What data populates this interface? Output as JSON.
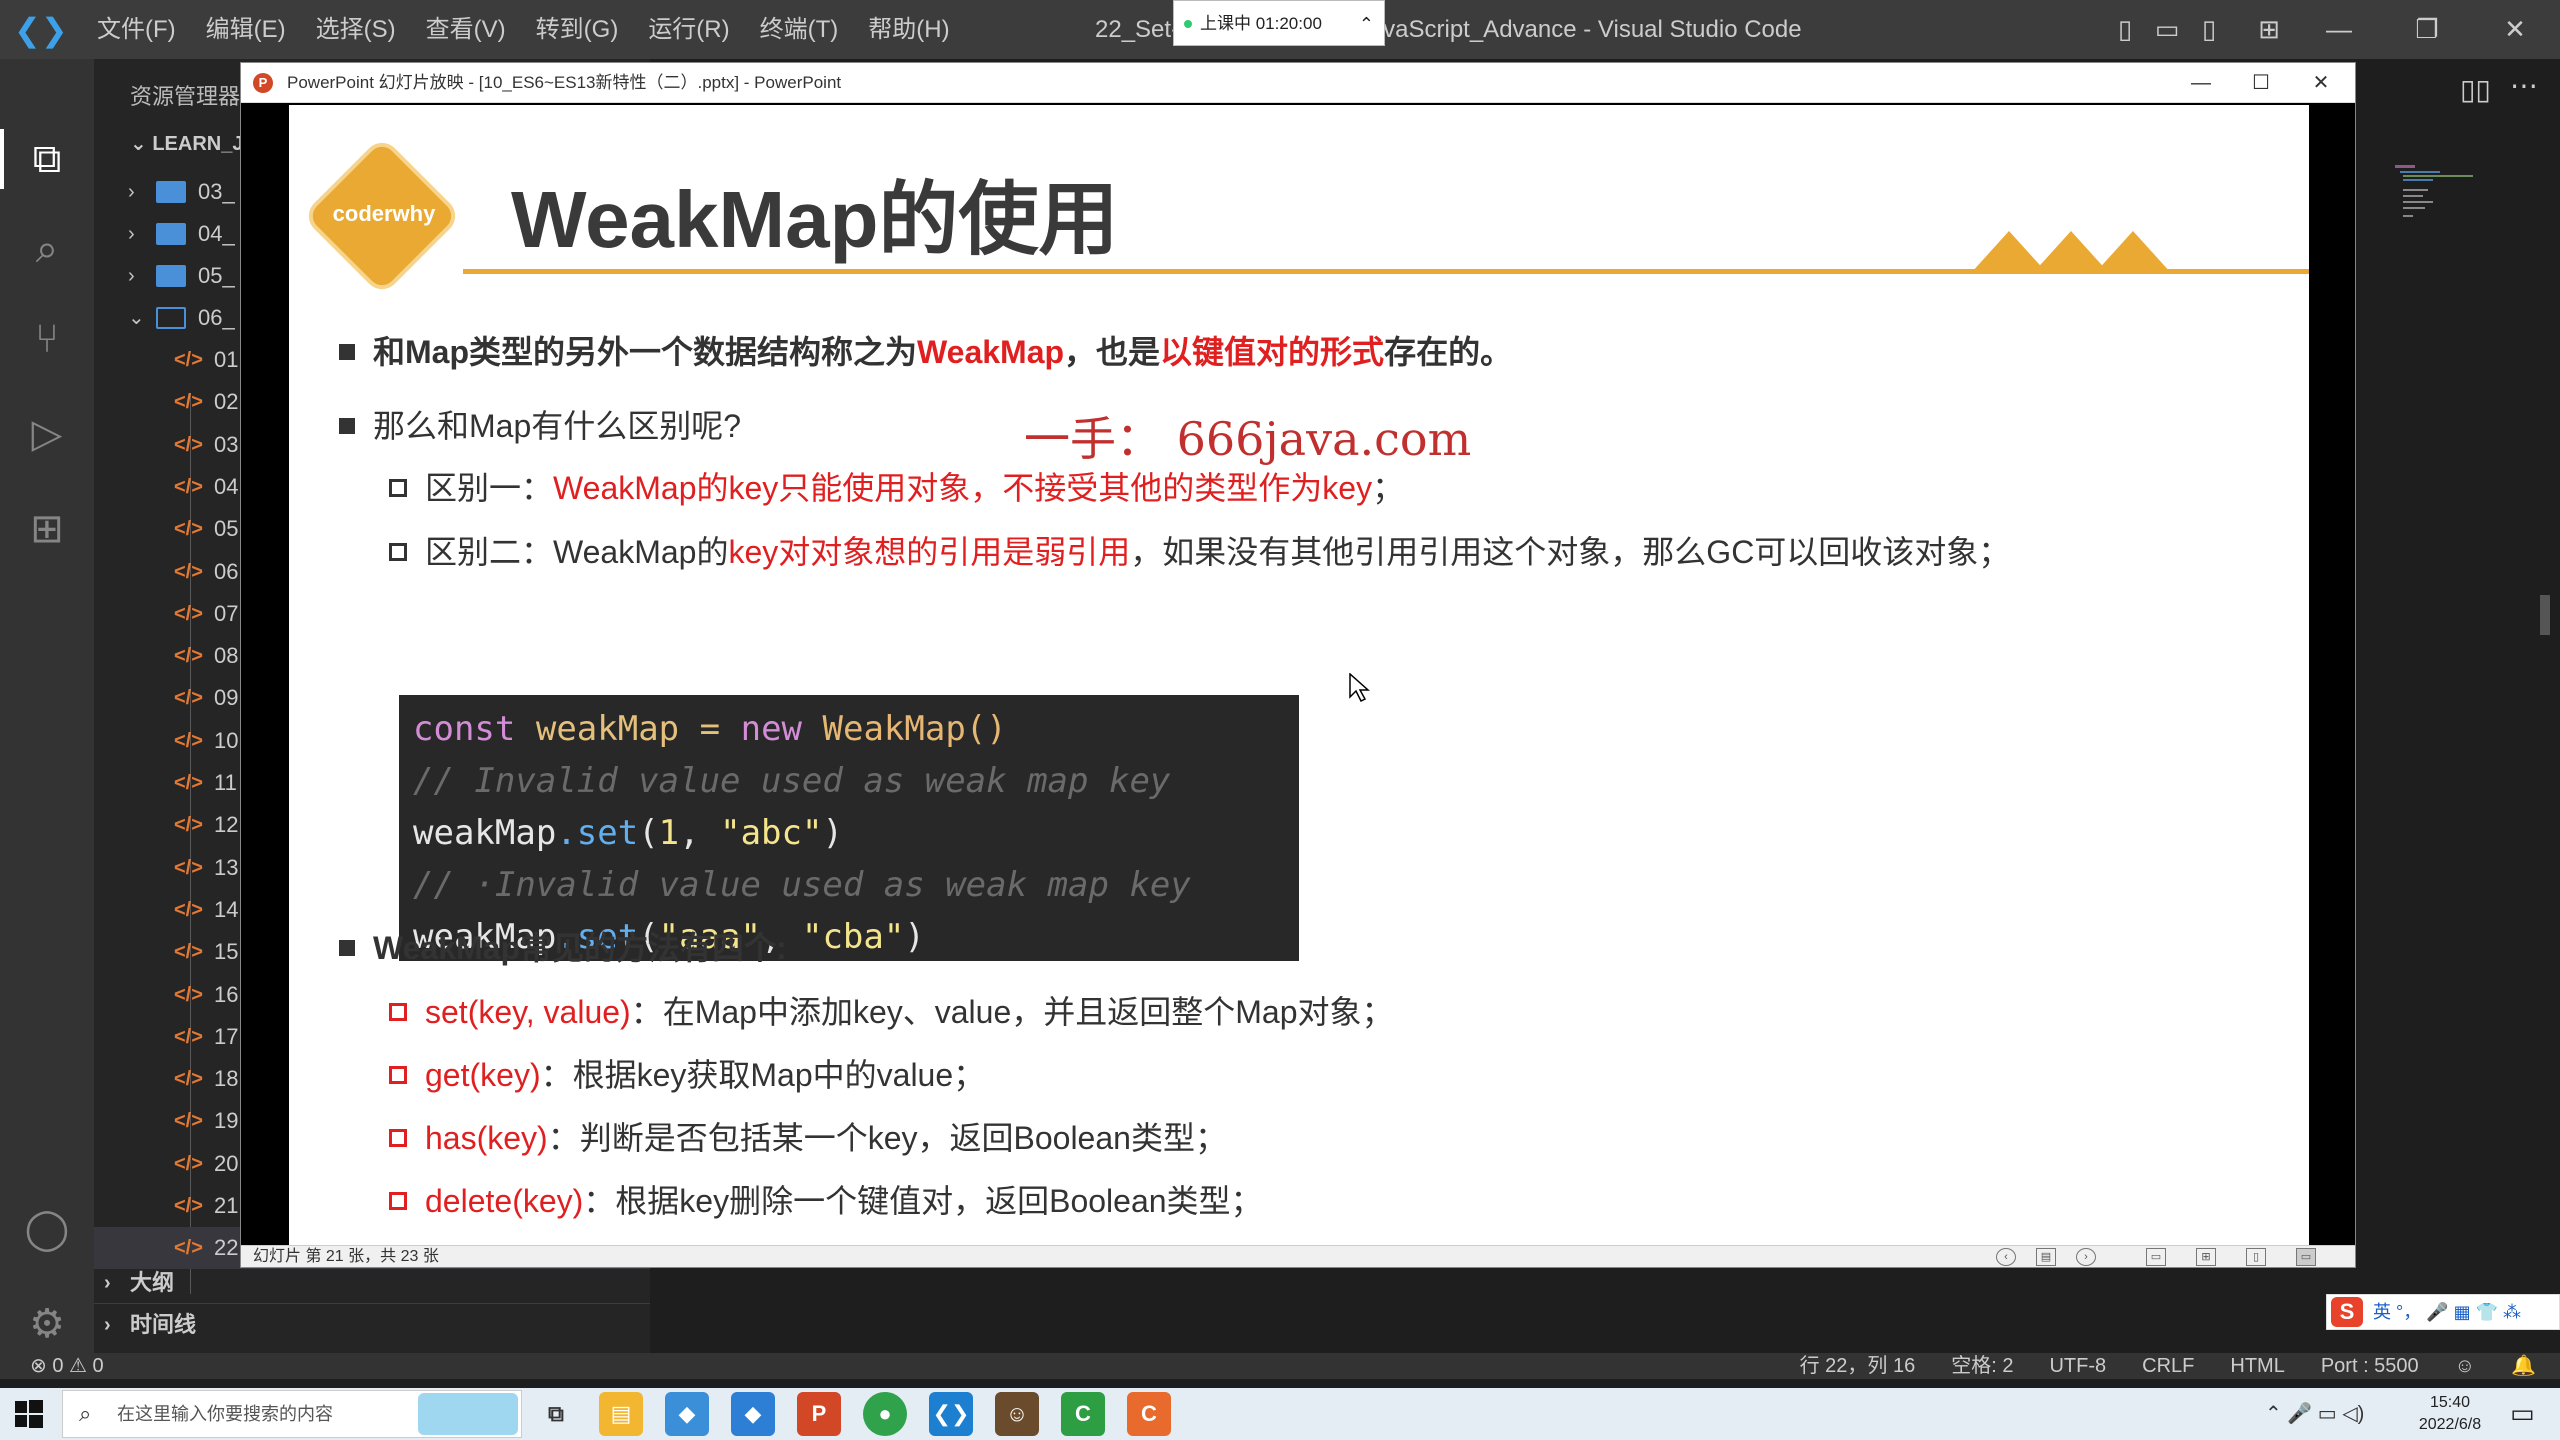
{
  "vscode": {
    "menu": [
      "文件(F)",
      "编辑(E)",
      "选择(S)",
      "查看(V)",
      "转到(G)",
      "运行(R)",
      "终端(T)",
      "帮助(H)"
    ],
    "window_title": "22_Set-                              用.html - Learn_JavaScript_Advance - Visual Studio Code",
    "class_badge": "上课中 01:20:00",
    "explorer_title": "资源管理器",
    "root_folder": "LEARN_JAV",
    "folders": [
      {
        "name": "03_",
        "open": false
      },
      {
        "name": "04_",
        "open": false
      },
      {
        "name": "05_",
        "open": false
      },
      {
        "name": "06_",
        "open": true
      }
    ],
    "files": [
      "01",
      "02",
      "03",
      "04",
      "05",
      "06",
      "07",
      "08",
      "09",
      "10",
      "11",
      "12",
      "13",
      "14",
      "15",
      "16",
      "17",
      "18",
      "19",
      "20",
      "21",
      "22"
    ],
    "sections": [
      "大纲",
      "时间线"
    ],
    "status_left": "⊗ 0 ⚠ 0",
    "status_right": [
      "行 22，列 16",
      "空格: 2",
      "UTF-8",
      "CRLF",
      "HTML",
      "Port : 5500"
    ]
  },
  "ppt": {
    "window_title": "PowerPoint 幻灯片放映 - [10_ES6~ES13新特性（二）.pptx] - PowerPoint",
    "status": "幻灯片 第 21 张，共 23 张",
    "slide": {
      "logo": "coderwhy",
      "title": "WeakMap的使用",
      "watermark": "一手：  666java.com",
      "b1": {
        "p1": "和Map类型的另外一个数据结构称之为",
        "p2": "WeakMap",
        "p3": "，也是",
        "p4": "以键值对的形式",
        "p5": "存在的。"
      },
      "b2": "那么和Map有什么区别呢?",
      "d1": {
        "p1": "区别一：",
        "p2": "WeakMap的key只能使用对象，不接受其他的类型作为key",
        "p3": "；"
      },
      "d2": {
        "p1": "区别二：WeakMap的",
        "p2": "key对对象想的引用是弱引用",
        "p3": "，如果没有其他引用引用这个对象，那么GC可以回收该对象；"
      },
      "code": {
        "l1": {
          "kw1": "const",
          "v": "weakMap",
          "op": "=",
          "kw2": "new",
          "cls": "WeakMap()"
        },
        "l2": "// Invalid value used as weak map key",
        "l3": {
          "obj": "weakMap",
          "m": ".set",
          "open": "(",
          "n": "1",
          "comma": ", ",
          "s": "\"abc\"",
          "close": ")"
        },
        "l4": "// ·Invalid value used as weak map key",
        "l5": {
          "obj": "weakMap",
          "m": ".set",
          "open": "(",
          "s1": "\"aaa\"",
          "comma": ", ",
          "s2": "\"cba\"",
          "close": ")"
        }
      },
      "b3": "WeakMap常见的方法有四个:",
      "methods": [
        {
          "name": "set(key, value)",
          "desc": "：在Map中添加key、value，并且返回整个Map对象；"
        },
        {
          "name": "get(key)",
          "desc": "：根据key获取Map中的value；"
        },
        {
          "name": "has(key)",
          "desc": "：判断是否包括某一个key，返回Boolean类型；"
        },
        {
          "name": "delete(key)",
          "desc": "：根据key删除一个键值对，返回Boolean类型；"
        }
      ]
    }
  },
  "ime": {
    "label": "英 °， 🎤 ▦ 👕 ⁂"
  },
  "taskbar": {
    "search_placeholder": "在这里输入你要搜索的内容",
    "time": "15:40",
    "date": "2022/6/8"
  },
  "colors": {
    "accent": "#e9a932",
    "red": "#e02020",
    "vscode_blue": "#007acc"
  }
}
